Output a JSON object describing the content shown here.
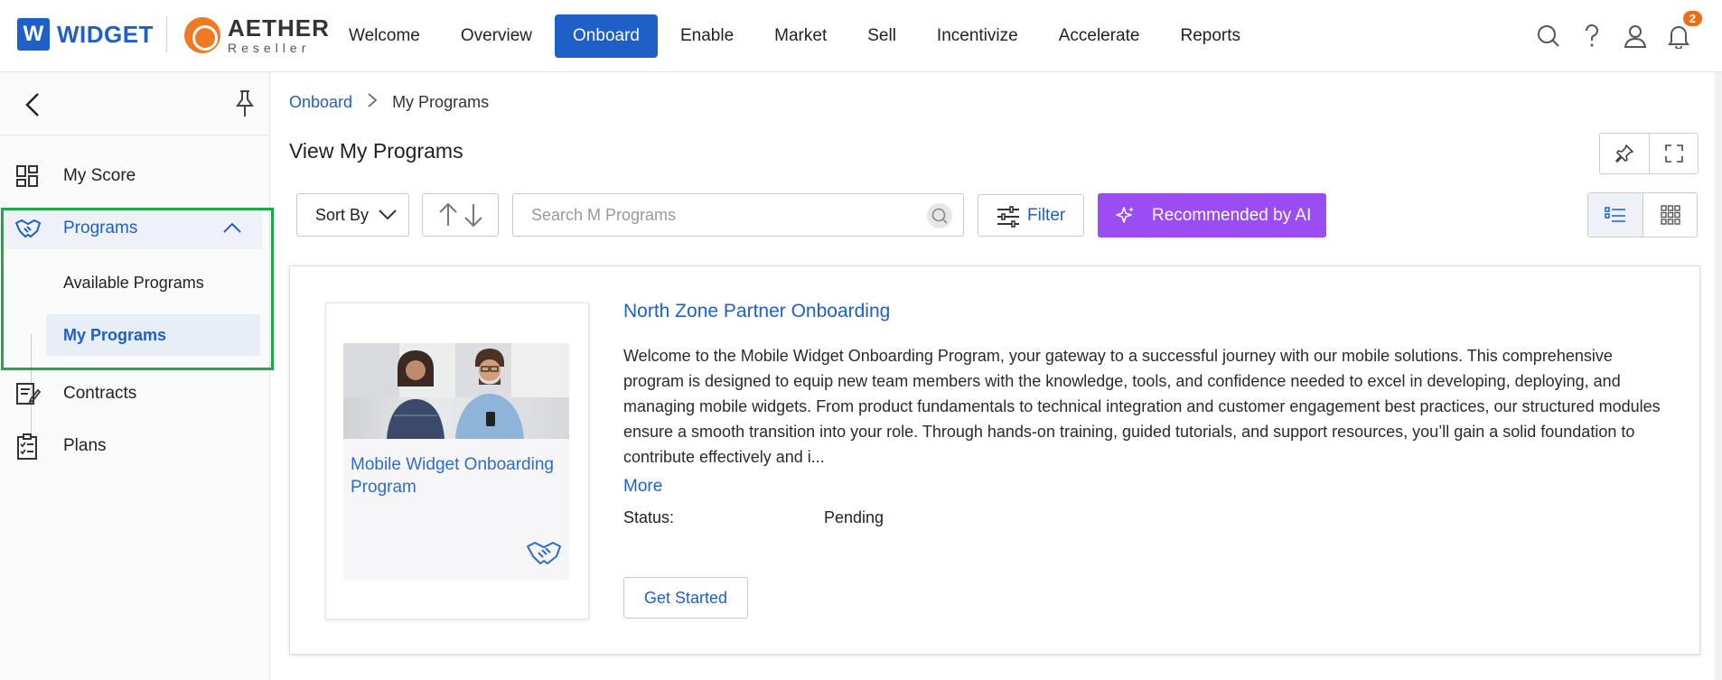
{
  "brand": {
    "widget_letter": "W",
    "widget_name": "WIDGET",
    "aether_name": "AETHER",
    "aether_sub": "Reseller"
  },
  "nav": {
    "items": [
      {
        "label": "Welcome"
      },
      {
        "label": "Overview"
      },
      {
        "label": "Onboard",
        "active": true
      },
      {
        "label": "Enable"
      },
      {
        "label": "Market"
      },
      {
        "label": "Sell"
      },
      {
        "label": "Incentivize"
      },
      {
        "label": "Accelerate"
      },
      {
        "label": "Reports"
      }
    ],
    "notification_count": "2"
  },
  "sidebar": {
    "items": [
      {
        "label": "My Score",
        "icon": "dashboard-icon"
      },
      {
        "label": "Programs",
        "icon": "handshake-icon",
        "expanded": true
      },
      {
        "label": "Contracts",
        "icon": "contract-icon"
      },
      {
        "label": "Plans",
        "icon": "checklist-icon"
      }
    ],
    "sub_items": [
      {
        "label": "Available Programs"
      },
      {
        "label": "My Programs",
        "selected": true
      }
    ]
  },
  "breadcrumb": {
    "parent": "Onboard",
    "current": "My Programs"
  },
  "page": {
    "title": "View My Programs"
  },
  "toolbar": {
    "sort_label": "Sort By",
    "search_placeholder": "Search M Programs",
    "filter_label": "Filter",
    "ai_label": "Recommended by AI"
  },
  "program": {
    "thumb_title": "Mobile Widget Onboarding Program",
    "title": "North Zone Partner Onboarding",
    "description": "Welcome to the Mobile Widget Onboarding Program, your gateway to a successful journey with our mobile solutions. This comprehensive program is designed to equip new team members with the knowledge, tools, and confidence needed to excel in developing, deploying, and managing mobile widgets. From product fundamentals to technical integration and customer engagement best practices, our structured modules ensure a smooth transition into your role. Through hands-on training, guided tutorials, and support resources, you’ll gain a solid foundation to contribute effectively and i...",
    "more_label": "More",
    "status_label": "Status:",
    "status_value": "Pending",
    "action_label": "Get Started"
  },
  "colors": {
    "primary": "#1f5fc8",
    "ai_purple": "#9b4cf2",
    "badge_orange": "#ef6c13",
    "highlight_green": "#1fa84a"
  }
}
